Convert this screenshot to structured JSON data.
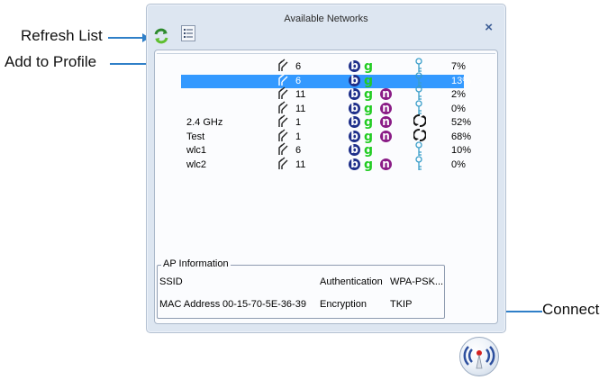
{
  "callouts": {
    "refresh": "Refresh List",
    "add_profile": "Add to Profile",
    "connect": "Connect"
  },
  "dialog": {
    "title": "Available Networks",
    "close_glyph": "×"
  },
  "networks": [
    {
      "ssid": "",
      "channel": "6",
      "modes": [
        "b",
        "g"
      ],
      "security": "key-icon",
      "signal": "7%",
      "selected": false
    },
    {
      "ssid": "",
      "channel": "6",
      "modes": [
        "b",
        "g"
      ],
      "security": "key-icon",
      "signal": "13%",
      "selected": true
    },
    {
      "ssid": "",
      "channel": "11",
      "modes": [
        "b",
        "g",
        "n"
      ],
      "security": "key-icon",
      "signal": "2%",
      "selected": false
    },
    {
      "ssid": "",
      "channel": "11",
      "modes": [
        "b",
        "g",
        "n"
      ],
      "security": "key-icon",
      "signal": "0%",
      "selected": false
    },
    {
      "ssid": "2.4 GHz",
      "channel": "1",
      "modes": [
        "b",
        "g",
        "n"
      ],
      "security": "wps-icon",
      "signal": "52%",
      "selected": false
    },
    {
      "ssid": "Test",
      "channel": "1",
      "modes": [
        "b",
        "g",
        "n"
      ],
      "security": "wps-icon",
      "signal": "68%",
      "selected": false
    },
    {
      "ssid": "wlc1",
      "channel": "6",
      "modes": [
        "b",
        "g"
      ],
      "security": "key-icon",
      "signal": "10%",
      "selected": false
    },
    {
      "ssid": "wlc2",
      "channel": "11",
      "modes": [
        "b",
        "g",
        "n"
      ],
      "security": "key-icon",
      "signal": "0%",
      "selected": false
    }
  ],
  "ap_info": {
    "legend": "AP Information",
    "ssid_label": "SSID",
    "ssid_value": "",
    "mac_label": "MAC Address",
    "mac_value": "00-15-70-5E-36-39",
    "auth_label": "Authentication",
    "auth_value": "WPA-PSK...",
    "enc_label": "Encryption",
    "enc_value": "TKIP"
  },
  "colors": {
    "accent": "#2f7fc8",
    "selection": "#3399ff",
    "mode_b": "#1e2f8a",
    "mode_g": "#22cc22",
    "mode_n": "#8a1c86"
  }
}
